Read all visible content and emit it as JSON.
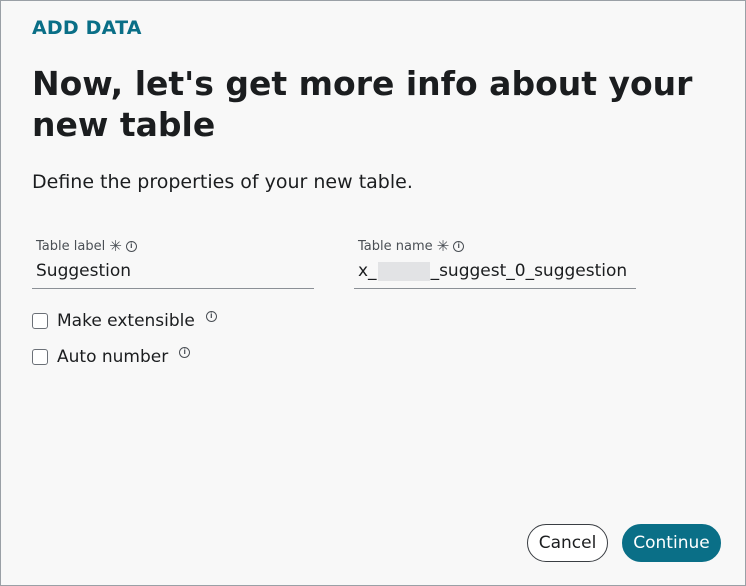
{
  "header": {
    "eyebrow": "ADD DATA",
    "title": "Now, let's get more info about your new table",
    "subtitle": "Define the properties of your new table."
  },
  "fields": {
    "table_label": {
      "label": "Table label",
      "required_mark": "✳",
      "value": "Suggestion"
    },
    "table_name": {
      "label": "Table name",
      "required_mark": "✳",
      "value_prefix": "x_",
      "value_suffix": "_suggest_0_suggestion"
    }
  },
  "options": [
    {
      "label": "Make extensible",
      "checked": false
    },
    {
      "label": "Auto number",
      "checked": false
    }
  ],
  "footer": {
    "cancel_label": "Cancel",
    "continue_label": "Continue"
  },
  "icons": {
    "info": "info-circle-icon",
    "required": "asterisk-icon"
  },
  "colors": {
    "accent": "#0a6f87",
    "text": "#1b1d1f",
    "background": "#f8f8f8"
  }
}
